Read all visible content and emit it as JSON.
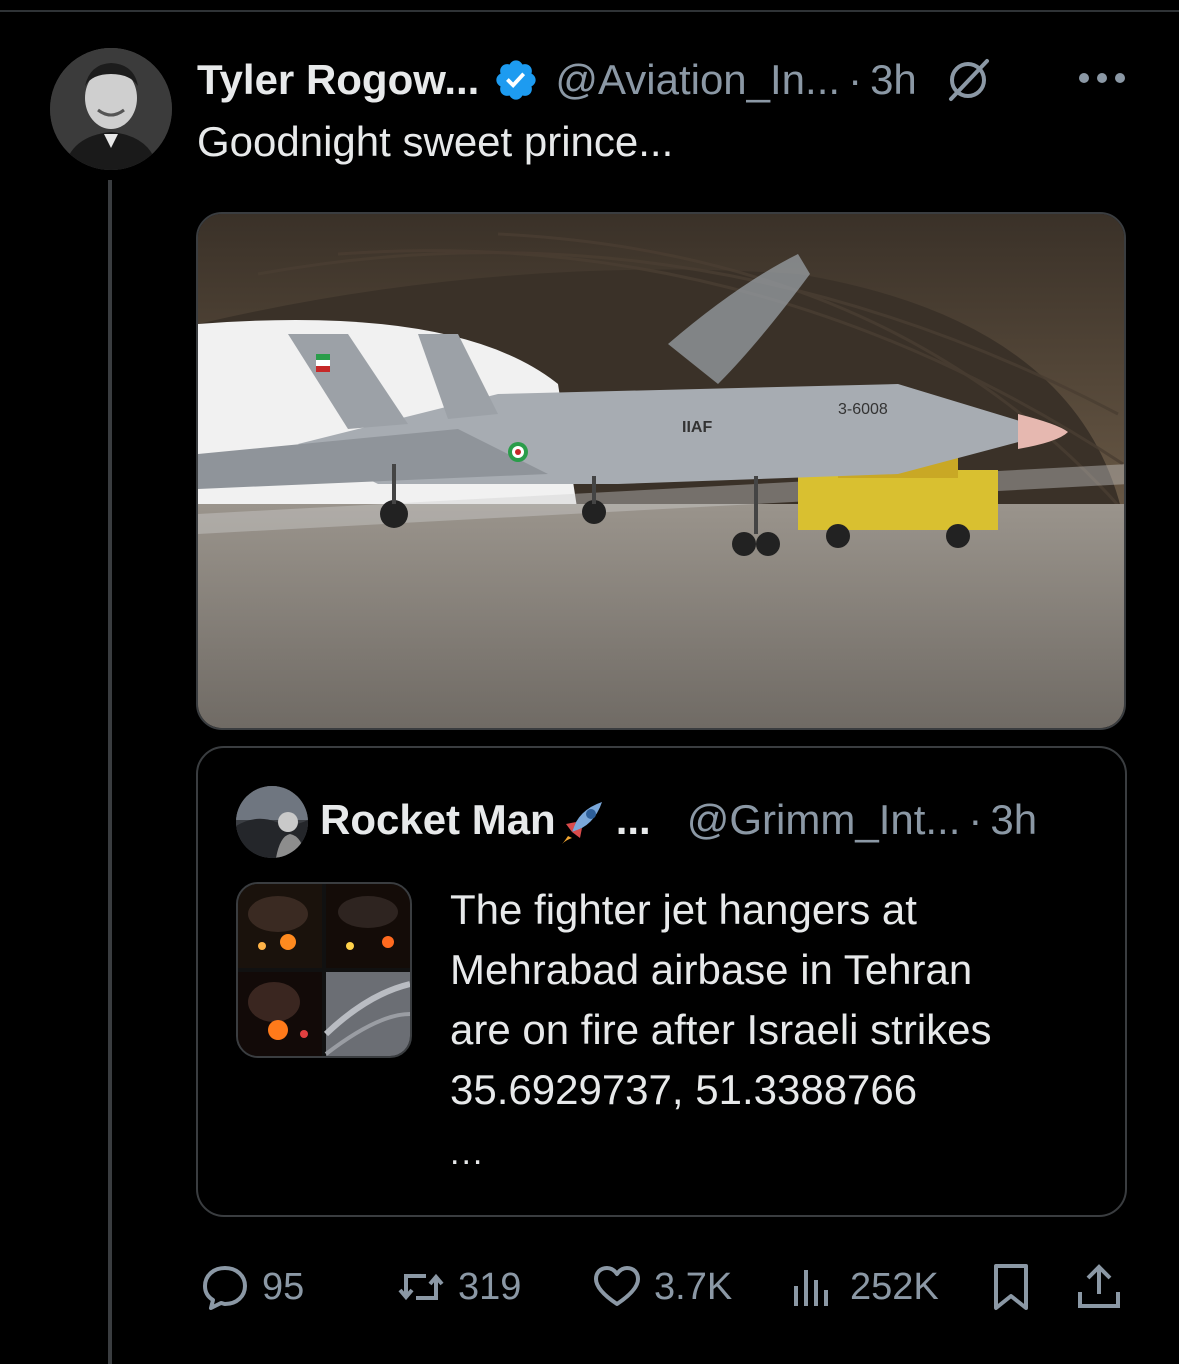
{
  "tweet": {
    "author_name": "Tyler Rogow...",
    "handle": "@Aviation_In...",
    "separator": "·",
    "time": "3h",
    "text": "Goodnight sweet prince...",
    "image_labels": {
      "aircraft_code": "3-6008",
      "markings": "IIAF"
    }
  },
  "quote": {
    "author_name": "Rocket Man",
    "name_ellipsis": "...",
    "handle": "@Grimm_Int...",
    "separator": "·",
    "time": "3h",
    "text_lines": [
      "The fighter jet hangers at",
      "Mehrabad airbase in Tehran",
      "are on fire after Israeli strikes",
      "35.6929737, 51.3388766"
    ],
    "more": "..."
  },
  "actions": {
    "replies": "95",
    "retweets": "319",
    "likes": "3.7K",
    "views": "252K"
  },
  "icons": {
    "verified": "verified-badge-icon",
    "grok": "grok-icon",
    "more": "more-dots-icon",
    "reply": "reply-bubble-icon",
    "retweet": "retweet-icon",
    "like": "heart-icon",
    "views": "views-bar-chart-icon",
    "bookmark": "bookmark-icon",
    "share": "share-icon",
    "rocket": "rocket-emoji-icon"
  },
  "colors": {
    "background": "#000000",
    "text": "#e7e9ea",
    "muted": "#8b98a5",
    "verified": "#1d9bf0",
    "border": "#3a3d40"
  }
}
